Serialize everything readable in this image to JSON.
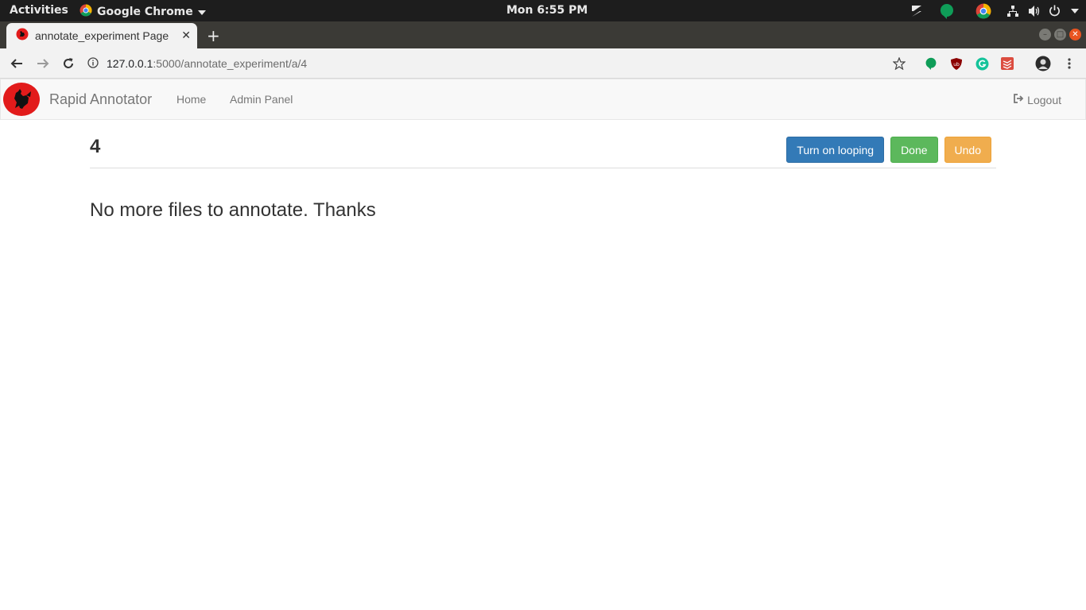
{
  "system_bar": {
    "activities": "Activities",
    "app_name": "Google Chrome",
    "clock": "Mon  6:55 PM"
  },
  "browser": {
    "tab_title": "annotate_experiment Page",
    "url_host": "127.0.0.1",
    "url_path": ":5000/annotate_experiment/a/4"
  },
  "navbar": {
    "brand": "Rapid Annotator",
    "links": [
      "Home",
      "Admin Panel"
    ],
    "logout": "Logout"
  },
  "page": {
    "title": "4",
    "buttons": {
      "looping": "Turn on looping",
      "done": "Done",
      "undo": "Undo"
    },
    "message": "No more files to annotate. Thanks"
  },
  "colors": {
    "primary": "#337ab7",
    "success": "#5cb85c",
    "warning": "#f0ad4e"
  }
}
